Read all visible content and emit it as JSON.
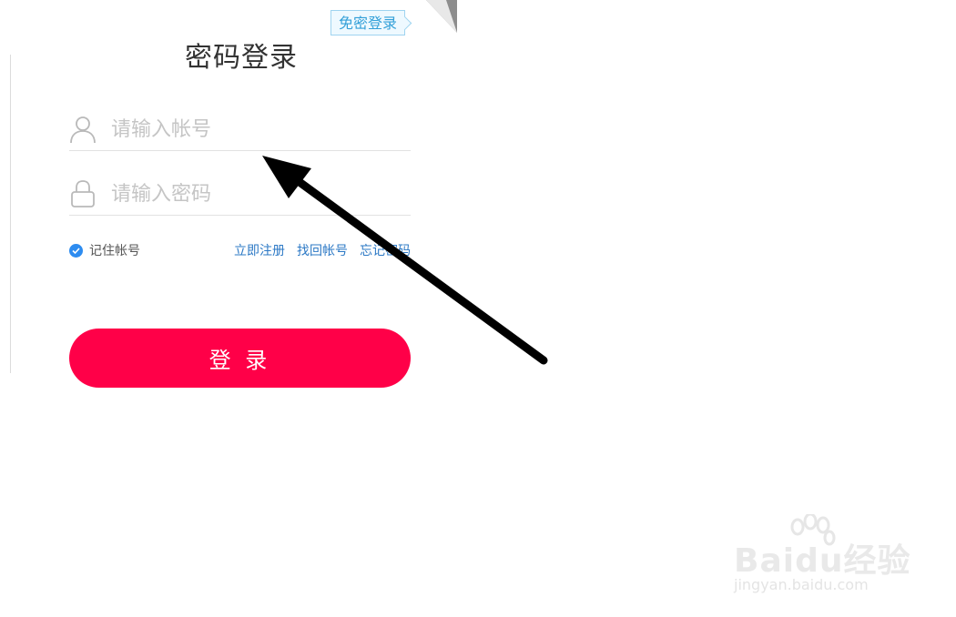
{
  "login": {
    "title": "密码登录",
    "qr_login_label": "免密登录",
    "account_placeholder": "请输入帐号",
    "password_placeholder": "请输入密码",
    "remember_label": "记住帐号",
    "remember_checked": true,
    "links": [
      "立即注册",
      "找回帐号",
      "忘记密码"
    ],
    "submit_label": "登 录"
  },
  "colors": {
    "button": "#ff0048",
    "link": "#2b78c5",
    "checkbox": "#2d8cf0",
    "badge_text": "#33a0d8"
  },
  "icons": [
    "user-icon",
    "lock-icon",
    "check-icon",
    "arrow-annotation"
  ],
  "watermark": {
    "brand": "Baidu经验",
    "url": "jingyan.baidu.com"
  }
}
